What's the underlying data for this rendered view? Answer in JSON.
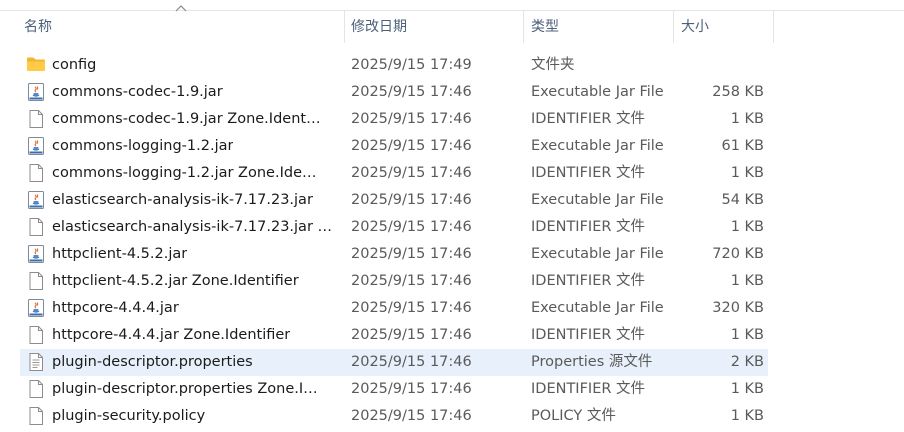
{
  "columns": {
    "name": "名称",
    "date": "修改日期",
    "type": "类型",
    "size": "大小"
  },
  "files": [
    {
      "name": "config",
      "date": "2025/9/15 17:49",
      "type": "文件夹",
      "size": "",
      "icon": "folder-icon"
    },
    {
      "name": "commons-codec-1.9.jar",
      "date": "2025/9/15 17:46",
      "type": "Executable Jar File",
      "size": "258 KB",
      "icon": "jar-icon"
    },
    {
      "name": "commons-codec-1.9.jar   Zone.Ident…",
      "date": "2025/9/15 17:46",
      "type": "IDENTIFIER 文件",
      "size": "1 KB",
      "icon": "file-icon"
    },
    {
      "name": "commons-logging-1.2.jar",
      "date": "2025/9/15 17:46",
      "type": "Executable Jar File",
      "size": "61 KB",
      "icon": "jar-icon"
    },
    {
      "name": "commons-logging-1.2.jar   Zone.Ide…",
      "date": "2025/9/15 17:46",
      "type": "IDENTIFIER 文件",
      "size": "1 KB",
      "icon": "file-icon"
    },
    {
      "name": "elasticsearch-analysis-ik-7.17.23.jar",
      "date": "2025/9/15 17:46",
      "type": "Executable Jar File",
      "size": "54 KB",
      "icon": "jar-icon"
    },
    {
      "name": "elasticsearch-analysis-ik-7.17.23.jar   …",
      "date": "2025/9/15 17:46",
      "type": "IDENTIFIER 文件",
      "size": "1 KB",
      "icon": "file-icon"
    },
    {
      "name": "httpclient-4.5.2.jar",
      "date": "2025/9/15 17:46",
      "type": "Executable Jar File",
      "size": "720 KB",
      "icon": "jar-icon"
    },
    {
      "name": "httpclient-4.5.2.jar   Zone.Identifier",
      "date": "2025/9/15 17:46",
      "type": "IDENTIFIER 文件",
      "size": "1 KB",
      "icon": "file-icon"
    },
    {
      "name": "httpcore-4.4.4.jar",
      "date": "2025/9/15 17:46",
      "type": "Executable Jar File",
      "size": "320 KB",
      "icon": "jar-icon"
    },
    {
      "name": "httpcore-4.4.4.jar   Zone.Identifier",
      "date": "2025/9/15 17:46",
      "type": "IDENTIFIER 文件",
      "size": "1 KB",
      "icon": "file-icon"
    },
    {
      "name": "plugin-descriptor.properties",
      "date": "2025/9/15 17:46",
      "type": "Properties 源文件",
      "size": "2 KB",
      "icon": "properties-file-icon",
      "selected": true
    },
    {
      "name": "plugin-descriptor.properties   Zone.I…",
      "date": "2025/9/15 17:46",
      "type": "IDENTIFIER 文件",
      "size": "1 KB",
      "icon": "file-icon"
    },
    {
      "name": "plugin-security.policy",
      "date": "2025/9/15 17:46",
      "type": "POLICY 文件",
      "size": "1 KB",
      "icon": "file-icon"
    }
  ]
}
